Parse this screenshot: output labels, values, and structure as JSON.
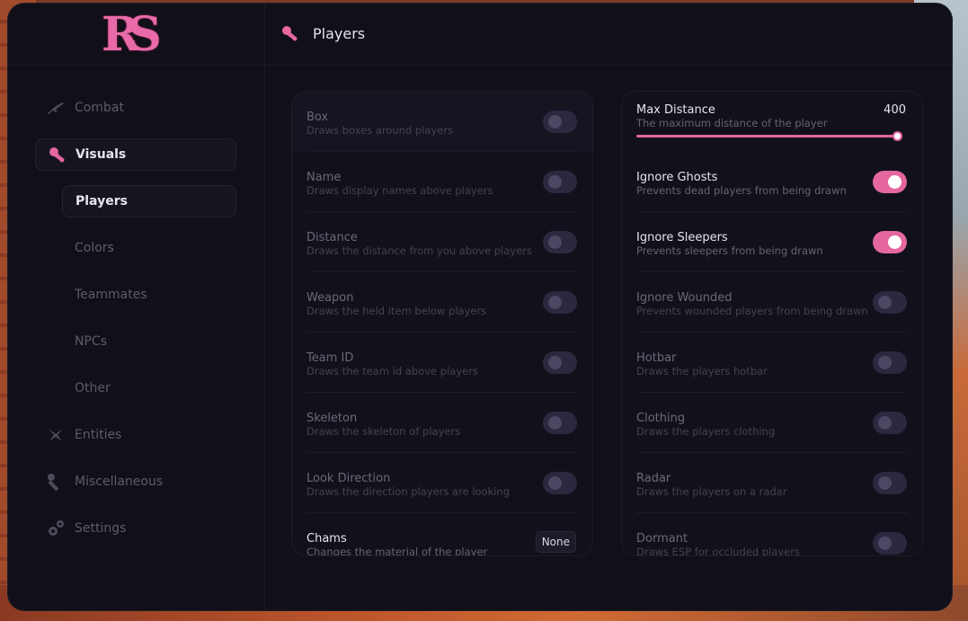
{
  "app": {
    "logo_text": "RS"
  },
  "header": {
    "title": "Players",
    "icon": "visuals-icon"
  },
  "sidebar": {
    "items": [
      {
        "label": "Combat",
        "icon": "rifle-icon",
        "active": false
      },
      {
        "label": "Visuals",
        "icon": "visuals-icon",
        "active": true
      },
      {
        "label": "Entities",
        "icon": "entities-icon",
        "active": false
      },
      {
        "label": "Miscellaneous",
        "icon": "wrench-icon",
        "active": false
      },
      {
        "label": "Settings",
        "icon": "gears-icon",
        "active": false
      }
    ],
    "subitems": [
      {
        "label": "Players",
        "active": true
      },
      {
        "label": "Colors",
        "active": false
      },
      {
        "label": "Teammates",
        "active": false
      },
      {
        "label": "NPCs",
        "active": false
      },
      {
        "label": "Other",
        "active": false
      }
    ]
  },
  "left_panel": {
    "rows": [
      {
        "title": "Box",
        "desc": "Draws boxes around players",
        "enabled": false
      },
      {
        "title": "Name",
        "desc": "Draws display names above players",
        "enabled": false
      },
      {
        "title": "Distance",
        "desc": "Draws the distance from you above players",
        "enabled": false
      },
      {
        "title": "Weapon",
        "desc": "Draws the held item below players",
        "enabled": false
      },
      {
        "title": "Team ID",
        "desc": "Draws the team id above players",
        "enabled": false
      },
      {
        "title": "Skeleton",
        "desc": "Draws the skeleton of players",
        "enabled": false
      },
      {
        "title": "Look Direction",
        "desc": "Draws the direction players are looking",
        "enabled": false
      }
    ],
    "chams": {
      "title": "Chams",
      "desc": "Changes the material of the player",
      "value": "None"
    }
  },
  "right_panel": {
    "max_distance": {
      "title": "Max Distance",
      "desc": "The maximum distance of the player",
      "value": "400",
      "fraction": 1.0
    },
    "rows": [
      {
        "title": "Ignore Ghosts",
        "desc": "Prevents dead players from being drawn",
        "enabled": true
      },
      {
        "title": "Ignore Sleepers",
        "desc": "Prevents sleepers from being drawn",
        "enabled": true
      },
      {
        "title": "Ignore Wounded",
        "desc": "Prevents wounded players from being drawn",
        "enabled": false
      },
      {
        "title": "Hotbar",
        "desc": "Draws the players hotbar",
        "enabled": false
      },
      {
        "title": "Clothing",
        "desc": "Draws the players clothing",
        "enabled": false
      },
      {
        "title": "Radar",
        "desc": "Draws the players on a radar",
        "enabled": false
      },
      {
        "title": "Dormant",
        "desc": "Draws ESP for occluded players",
        "enabled": false
      }
    ]
  },
  "colors": {
    "accent": "#e4679f",
    "window_bg": "#111019",
    "panel_bg": "#12111b",
    "toggle_off": "#2a2940"
  }
}
